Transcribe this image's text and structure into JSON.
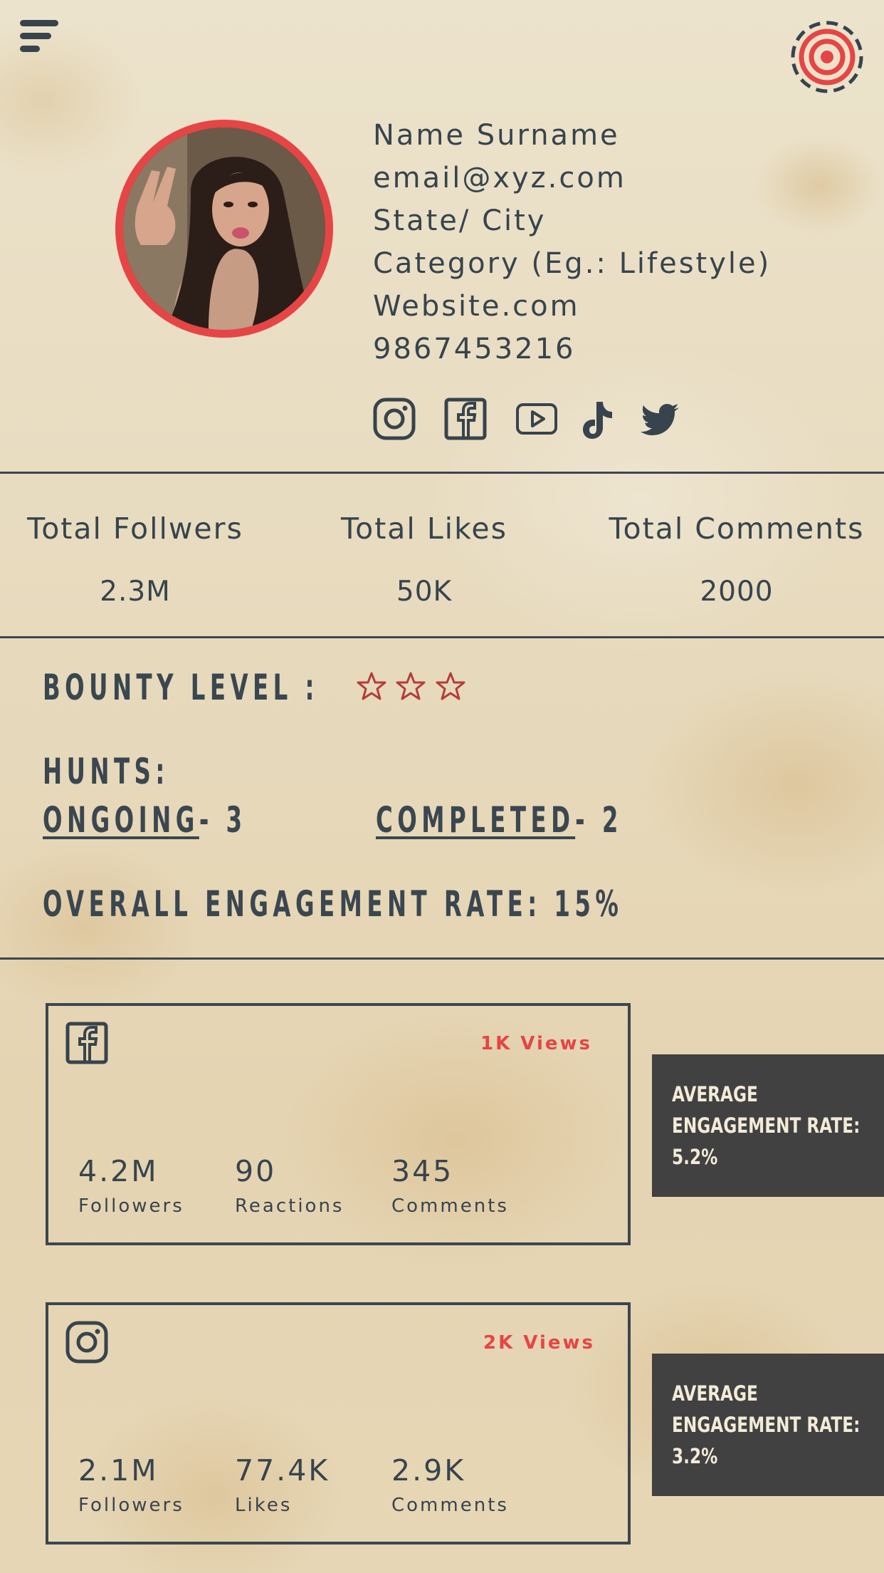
{
  "header": {
    "menu_icon": "hamburger-menu-icon",
    "target_icon": "target-icon",
    "accent_color": "#e64545"
  },
  "profile": {
    "name": "Name Surname",
    "email": "email@xyz.com",
    "location": "State/ City",
    "category": "Category (Eg.: Lifestyle)",
    "website": "Website.com",
    "phone": "9867453216",
    "socials": [
      "instagram-icon",
      "facebook-icon",
      "youtube-icon",
      "tiktok-icon",
      "twitter-icon"
    ]
  },
  "totals": {
    "followers_label": "Total Follwers",
    "followers_value": "2.3M",
    "likes_label": "Total Likes",
    "likes_value": "50K",
    "comments_label": "Total Comments",
    "comments_value": "2000"
  },
  "bounty": {
    "level_label": "BOUNTY LEVEL :",
    "stars_total": 3,
    "stars_filled": 0,
    "hunts_label": "HUNTS:",
    "ongoing_label": "ONGOING",
    "ongoing_value": "- 3",
    "completed_label": "COMPLETED",
    "completed_value": "- 2",
    "engagement_label": "OVERALL ENGAGEMENT RATE: 15%"
  },
  "platforms": [
    {
      "icon": "facebook-icon",
      "views": "1K Views",
      "stats": [
        {
          "value": "4.2M",
          "label": "Followers"
        },
        {
          "value": "90",
          "label": "Reactions"
        },
        {
          "value": "345",
          "label": "Comments"
        }
      ],
      "aer_line1": "AVERAGE",
      "aer_line2": "ENGAGEMENT RATE:",
      "aer_line3": "5.2%"
    },
    {
      "icon": "instagram-icon",
      "views": "2K Views",
      "stats": [
        {
          "value": "2.1M",
          "label": "Followers"
        },
        {
          "value": "77.4K",
          "label": "Likes"
        },
        {
          "value": "2.9K",
          "label": "Comments"
        }
      ],
      "aer_line1": "AVERAGE",
      "aer_line2": "ENGAGEMENT RATE:",
      "aer_line3": "3.2%"
    }
  ]
}
